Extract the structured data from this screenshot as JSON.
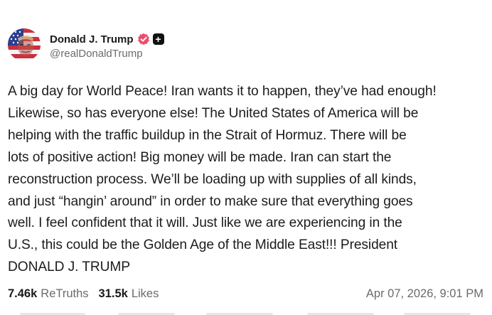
{
  "author": {
    "display_name": "Donald J. Trump",
    "handle": "@realDonaldTrump",
    "avatar_icon": "flag-portrait-avatar",
    "verified_icon": "verified-badge-icon",
    "plus_icon": "plus-badge-icon"
  },
  "post": {
    "lines": [
      "A big day for World Peace! Iran wants it to happen, they’ve had enough!",
      "Likewise, so has everyone else! The United States of America will be",
      "helping with the traffic buildup in the Strait of Hormuz. There will be",
      "lots of positive action! Big money will be made. Iran can start the",
      "reconstruction process. We’ll be loading up with supplies of all kinds,",
      "and just “hangin’ around” in order to make sure that everything goes",
      "well. I feel confident that it will. Just like we are experiencing in the",
      "U.S., this could be the Golden Age of the Middle East!!! President",
      "DONALD J. TRUMP"
    ]
  },
  "stats": {
    "retruths_count": "7.46k",
    "retruths_label": "ReTruths",
    "likes_count": "31.5k",
    "likes_label": "Likes",
    "timestamp": "Apr 07, 2026, 9:01 PM"
  },
  "colors": {
    "verified": "#e94f6a",
    "text": "#1c1c1c",
    "muted": "#6b6b6b"
  }
}
